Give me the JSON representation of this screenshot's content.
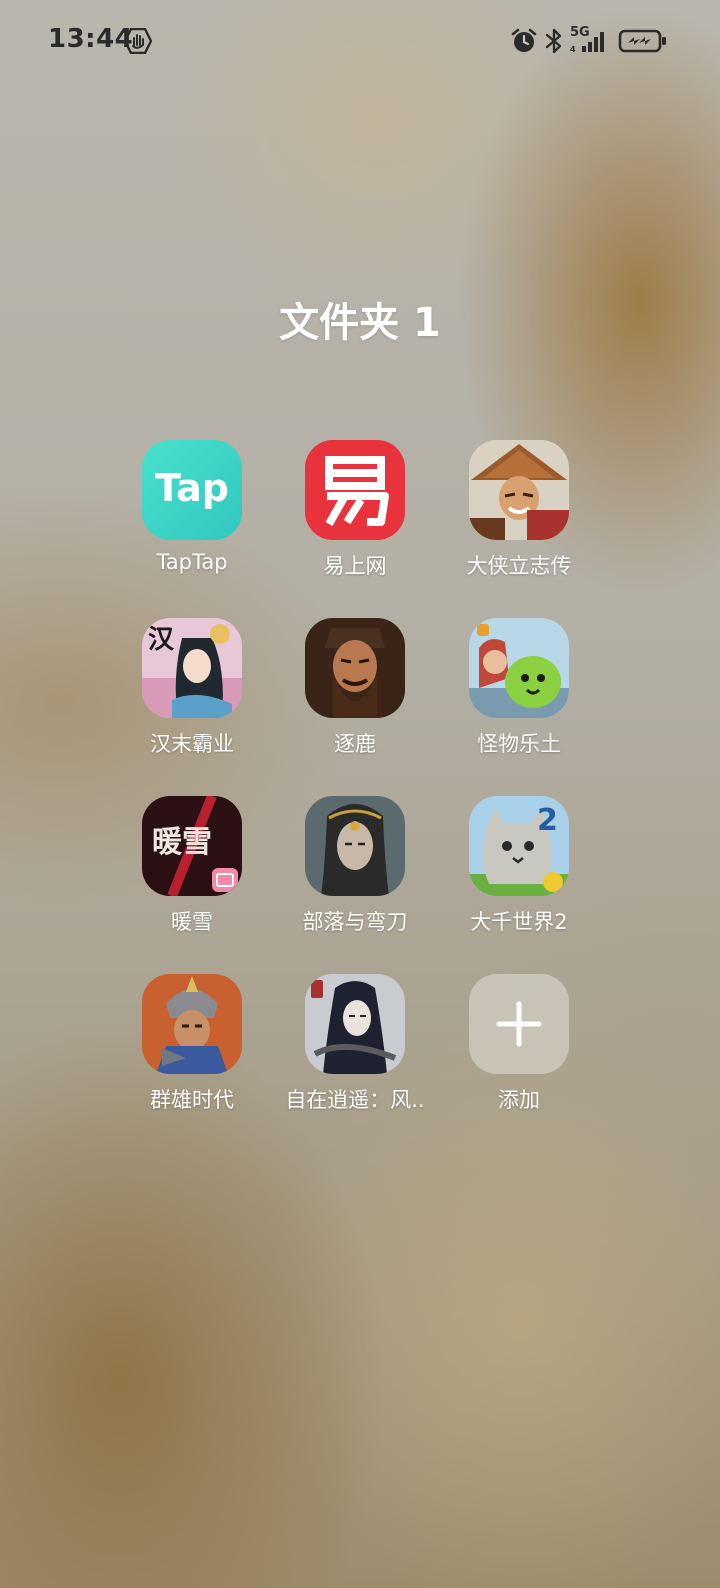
{
  "status_bar": {
    "time": "13:44",
    "network": "5G",
    "icons": [
      "hand-icon",
      "alarm-icon",
      "bluetooth-icon",
      "signal-icon",
      "battery-charging-icon"
    ]
  },
  "folder": {
    "title": "文件夹 1",
    "apps": [
      {
        "label": "TapTap",
        "icon": "taptap-icon",
        "icon_text": "Tap"
      },
      {
        "label": "易上网",
        "icon": "yishangwang-icon",
        "icon_text": "易"
      },
      {
        "label": "大侠立志传",
        "icon": "daxia-icon"
      },
      {
        "label": "汉末霸业",
        "icon": "hanmo-icon",
        "icon_text": "汉"
      },
      {
        "label": "逐鹿",
        "icon": "zhulu-icon"
      },
      {
        "label": "怪物乐土",
        "icon": "guaiwu-icon"
      },
      {
        "label": "暖雪",
        "icon": "nuanxue-icon",
        "icon_text": "暖雪"
      },
      {
        "label": "部落与弯刀",
        "icon": "buluo-icon"
      },
      {
        "label": "大千世界2",
        "icon": "daqian-icon",
        "icon_text": "2"
      },
      {
        "label": "群雄时代",
        "icon": "qunxiong-icon"
      },
      {
        "label": "自在逍遥：风..",
        "icon": "zizai-icon"
      },
      {
        "label": "添加",
        "icon": "add-icon"
      }
    ]
  },
  "colors": {
    "taptap": "#3fd8c7",
    "yishangwang": "#e8323c",
    "add_tile": "#c8c4bb"
  }
}
